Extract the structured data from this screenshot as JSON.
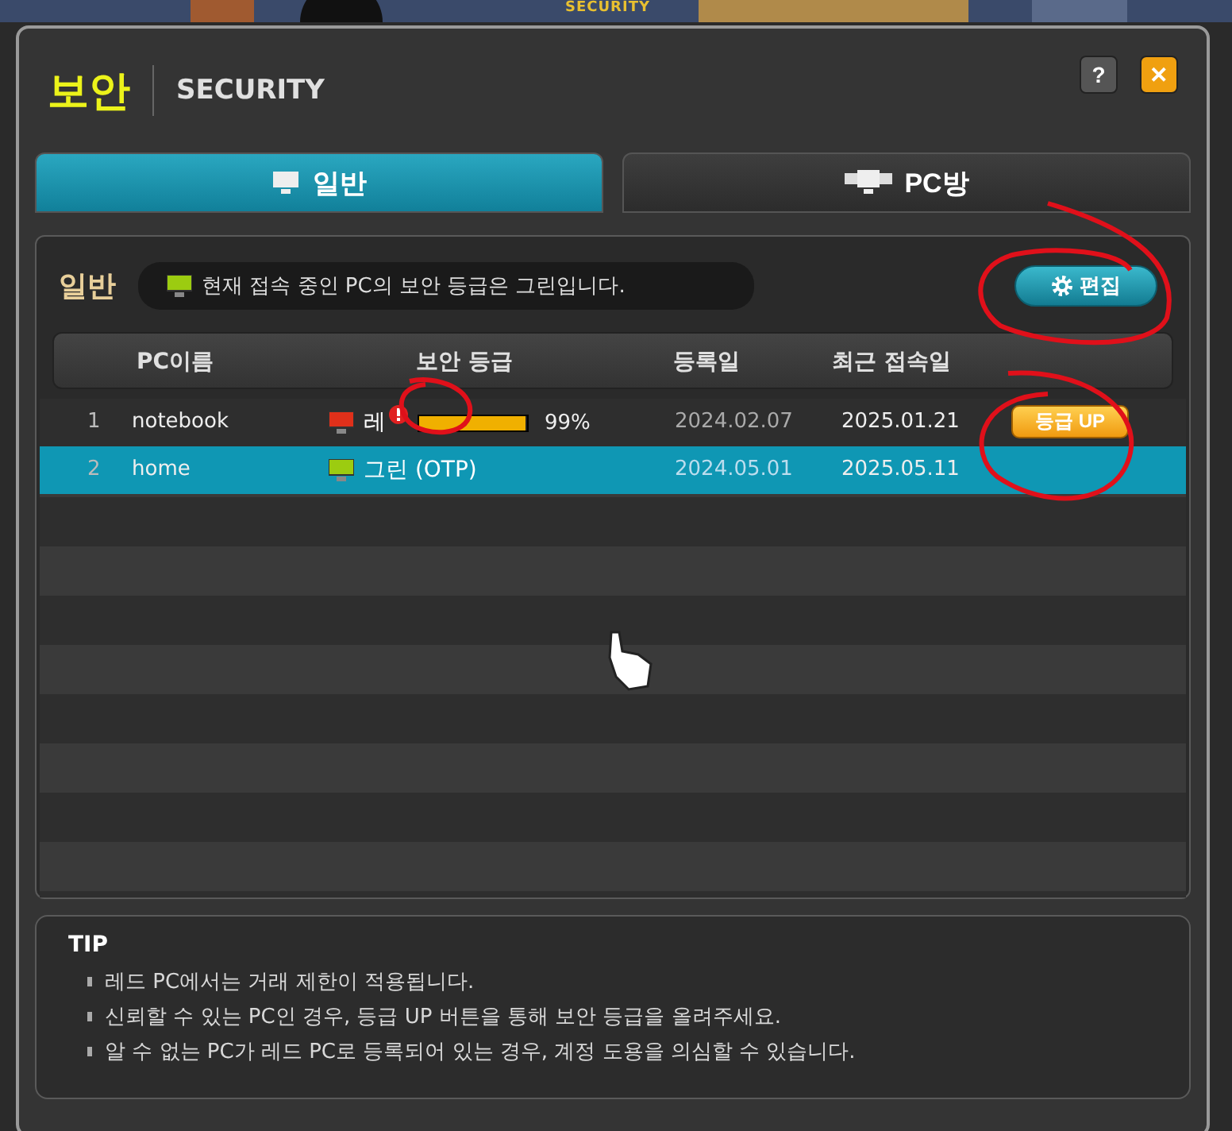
{
  "banner": {
    "title": "SECURITY"
  },
  "window": {
    "title": "보안",
    "subtitle": "SECURITY",
    "help": "?",
    "close": "✕"
  },
  "tabs": [
    {
      "label": "일반",
      "kind": "single",
      "selected": true
    },
    {
      "label": "PC방",
      "kind": "multi",
      "selected": false
    }
  ],
  "section": {
    "title": "일반",
    "status": "현재 접속 중인 PC의 보안 등급은 그린입니다.",
    "edit_button": "편집"
  },
  "table": {
    "columns": [
      "PC이름",
      "보안 등급",
      "등록일",
      "최근 접속일"
    ],
    "rows": [
      {
        "index": "1",
        "name": "notebook",
        "color": "#e0301a",
        "grade_label": "레",
        "warning": true,
        "level": 0.99,
        "percent": "99%",
        "registered": "2024.02.07",
        "last_access": "2025.01.21",
        "action": "등급 UP",
        "selected": false
      },
      {
        "index": "2",
        "name": "home",
        "color": "#9ccc10",
        "grade_label": "그린 (OTP)",
        "warning": false,
        "registered": "2024.05.01",
        "last_access": "2025.05.11",
        "selected": true
      }
    ]
  },
  "tip": {
    "title": "TIP",
    "items": [
      "레드 PC에서는 거래 제한이 적용됩니다.",
      "신뢰할 수 있는 PC인 경우, 등급 UP 버튼을 통해 보안 등급을 올려주세요.",
      "알 수 없는 PC가 레드 PC로 등록되어 있는 경우, 계정 도용을 의심할 수 있습니다."
    ]
  }
}
